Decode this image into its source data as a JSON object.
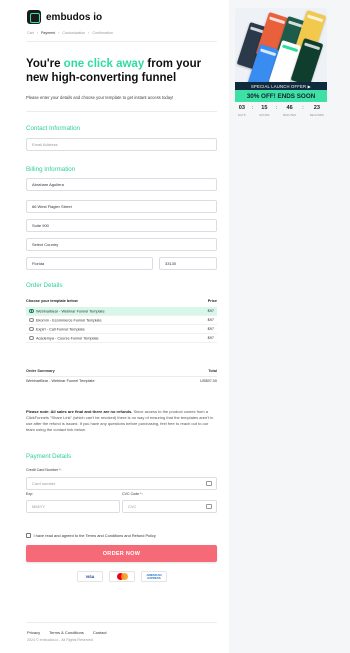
{
  "brand": {
    "name": "embudos io"
  },
  "breadcrumb": [
    "Cart",
    "Payment",
    "Customization",
    "Confirmation"
  ],
  "headline": {
    "pre": "You're ",
    "highlight": "one click away",
    "post": " from your new high-converting funnel"
  },
  "subtitle": "Please enter your details and choose your template to get instant access today!",
  "contact": {
    "title": "Contact Information",
    "email_placeholder": "Email Address"
  },
  "billing": {
    "title": "Billing Information",
    "name": "Abraham Aguilera",
    "street": "66 West Flagler Street",
    "suite": "Suite 900",
    "country": "Select Country",
    "state": "Florida",
    "zip": "33130"
  },
  "order": {
    "title": "Order Details",
    "choose_label": "Choose your template below",
    "price_label": "Price",
    "templates": [
      {
        "name": "WebinarBear - Webinar Funnel Template",
        "price": "$97",
        "selected": true
      },
      {
        "name": "Ekomm - Ecommerce Funnel Template",
        "price": "$97",
        "selected": false
      },
      {
        "name": "Expirt - Call Funnel Template",
        "price": "$97",
        "selected": false
      },
      {
        "name": "Academya - Course Funnel Template",
        "price": "$97",
        "selected": false
      }
    ],
    "summary_label": "Order Summary",
    "total_label": "Total",
    "summary_item": "WebinarBear - Webinar Funnel Template",
    "summary_price": "US$97.00"
  },
  "note": {
    "bold": "Please note: All sales are final and there are no refunds.",
    "body": " Since access to the product comes from a ClickFunnels \"Share Link\" (which can't be revoked) there is no way of ensuring that the templates aren't in use after the refund is issued. If you have any questions before purchasing, feel free to reach out to our team using the contact link below."
  },
  "payment": {
    "title": "Payment Details",
    "card_label": "Credit Card Number *:",
    "card_placeholder": "Card number",
    "exp_label": "Exp:",
    "exp_placeholder": "MM/YY",
    "cvc_label": "CVC Code *:",
    "cvc_placeholder": "CVC"
  },
  "agree": "I have read and agreed to the Terms and Conditions and Refund Policy",
  "order_button": "ORDER NOW",
  "cards": {
    "visa": "VISA",
    "amex": "AMERICAN EXPRESS"
  },
  "footer": {
    "links": [
      "Privacy",
      "Terms & Conditions",
      "Contact"
    ],
    "copyright": "2024 © embudos.io - All Rights Reserved"
  },
  "promo": {
    "banner": "SPECIAL LAUNCH OFFER ▶",
    "offer": "30% OFF! ENDS SOON",
    "countdown": [
      {
        "value": "03",
        "label": "DAYS"
      },
      {
        "value": "15",
        "label": "HOURS"
      },
      {
        "value": "46",
        "label": "MINUTES"
      },
      {
        "value": "23",
        "label": "SECONDS"
      }
    ]
  },
  "colors": {
    "accent": "#2fdca0",
    "button": "#f66a78",
    "banner_dark": "#102a3d",
    "banner_green": "#3ee0a5"
  }
}
